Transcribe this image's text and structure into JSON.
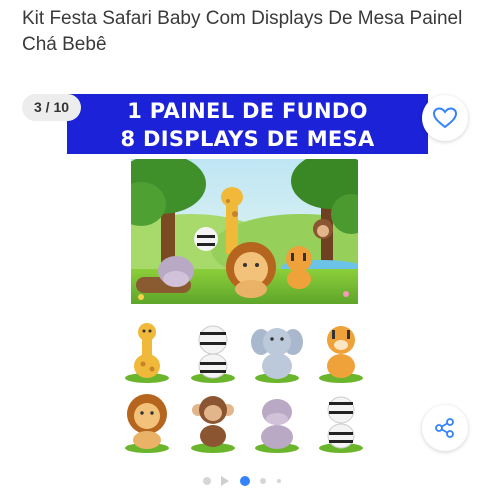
{
  "product": {
    "title": "Kit Festa Safari Baby Com Displays De Mesa Painel Chá Bebê"
  },
  "gallery": {
    "counter": "3 / 10",
    "current": 3,
    "total": 10,
    "banner_line1": "1 PAINEL DE FUNDO",
    "banner_line2": "8 DISPLAYS DE MESA",
    "banner_color": "#1c22d8",
    "accent_color": "#3483fa"
  },
  "icons": {
    "favorite": "heart-icon",
    "share": "share-icon"
  },
  "displays": [
    "giraffe",
    "zebra",
    "elephant",
    "tiger",
    "lion",
    "monkey",
    "hippo",
    "zebra"
  ]
}
